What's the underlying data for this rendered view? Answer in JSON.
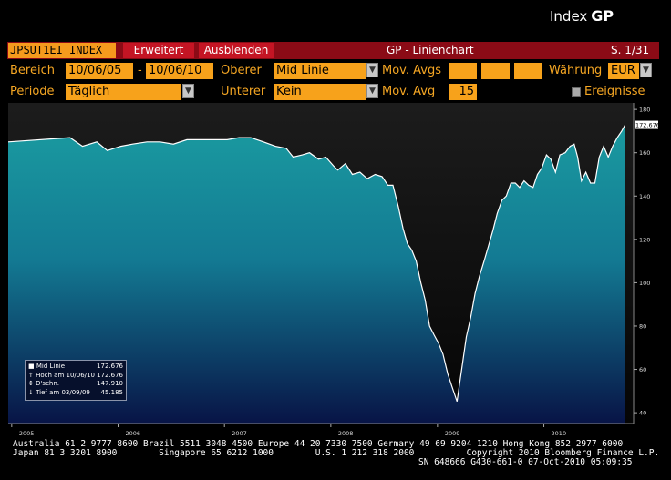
{
  "window": {
    "title": "Index",
    "title_bold": "GP"
  },
  "toolbar": {
    "ticker": "JPSUT1EI INDEX",
    "extended_label": "Erweitert",
    "hide_label": "Ausblenden",
    "chart_title": "GP - Linienchart",
    "page": "S. 1/31"
  },
  "controls": {
    "range_label": "Bereich",
    "date_from": "10/06/05",
    "date_sep": "-",
    "date_to": "10/06/10",
    "upper_label": "Oberer",
    "upper_value": "Mid Linie",
    "mov_avgs_label": "Mov. Avgs",
    "currency_label": "Währung",
    "currency_value": "EUR",
    "period_label": "Periode",
    "period_value": "Täglich",
    "lower_label": "Unterer",
    "lower_value": "Kein",
    "mov_avg_label": "Mov. Avg",
    "mov_avg_value": "15",
    "events_label": "Ereignisse"
  },
  "legend": {
    "rows": [
      {
        "label": "Mid Linie",
        "value": "172.676"
      },
      {
        "label": "Hoch am 10/06/10",
        "value": "172.676"
      },
      {
        "label": "D'schn.",
        "value": "147.910"
      },
      {
        "label": "Tief am 03/09/09",
        "value": "45.185"
      }
    ]
  },
  "footer": {
    "line1": "Australia 61 2 9777 8600 Brazil 5511 3048 4500 Europe 44 20 7330 7500 Germany 49 69 9204 1210 Hong Kong 852 2977 6000",
    "line2": "Japan 81 3 3201 8900        Singapore 65 6212 1000        U.S. 1 212 318 2000          Copyright 2010 Bloomberg Finance L.P.",
    "line3": "SN 648666 G430-661-0 07-Oct-2010 05:09:35"
  },
  "colors": {
    "accent": "#f7a21b",
    "bar": "#8b0b16",
    "fill_top": "#1a9aa0",
    "fill_bottom": "#0a1a4a"
  },
  "chart_data": {
    "type": "area",
    "title": "",
    "x_tick_labels": [
      "2005",
      "2006",
      "2007",
      "2008",
      "2009",
      "2010"
    ],
    "y_ticks": [
      40,
      60,
      80,
      100,
      120,
      140,
      160,
      180
    ],
    "ylim": [
      35,
      183
    ],
    "last_value_label": "172.676",
    "series": [
      {
        "name": "Mid Linie",
        "points": [
          [
            "2005-06-10",
            165
          ],
          [
            "2005-07-20",
            167
          ],
          [
            "2005-09-01",
            163
          ],
          [
            "2005-10-20",
            165
          ],
          [
            "2005-11-25",
            161
          ],
          [
            "2006-01-10",
            163
          ],
          [
            "2006-02-20",
            164
          ],
          [
            "2006-04-10",
            165
          ],
          [
            "2006-05-25",
            165
          ],
          [
            "2006-07-10",
            164
          ],
          [
            "2006-08-25",
            166
          ],
          [
            "2006-10-10",
            166
          ],
          [
            "2006-11-25",
            166
          ],
          [
            "2007-01-10",
            166
          ],
          [
            "2007-02-20",
            167
          ],
          [
            "2007-04-01",
            167
          ],
          [
            "2007-05-15",
            165
          ],
          [
            "2007-06-25",
            163
          ],
          [
            "2007-08-01",
            162
          ],
          [
            "2007-08-25",
            158
          ],
          [
            "2007-09-25",
            159
          ],
          [
            "2007-10-20",
            160
          ],
          [
            "2007-11-20",
            157
          ],
          [
            "2007-12-15",
            158
          ],
          [
            "2008-01-10",
            154
          ],
          [
            "2008-01-25",
            152
          ],
          [
            "2008-02-20",
            155
          ],
          [
            "2008-03-15",
            150
          ],
          [
            "2008-04-10",
            151
          ],
          [
            "2008-05-05",
            148
          ],
          [
            "2008-06-01",
            150
          ],
          [
            "2008-06-25",
            149
          ],
          [
            "2008-07-15",
            145
          ],
          [
            "2008-08-01",
            145
          ],
          [
            "2008-08-20",
            135
          ],
          [
            "2008-09-05",
            125
          ],
          [
            "2008-09-20",
            118
          ],
          [
            "2008-10-05",
            115
          ],
          [
            "2008-10-20",
            110
          ],
          [
            "2008-11-05",
            100
          ],
          [
            "2008-11-20",
            92
          ],
          [
            "2008-12-05",
            80
          ],
          [
            "2008-12-20",
            76
          ],
          [
            "2009-01-05",
            72
          ],
          [
            "2009-01-20",
            67
          ],
          [
            "2009-02-05",
            58
          ],
          [
            "2009-02-20",
            52
          ],
          [
            "2009-03-09",
            45.185
          ],
          [
            "2009-03-25",
            60
          ],
          [
            "2009-04-10",
            75
          ],
          [
            "2009-04-25",
            84
          ],
          [
            "2009-05-10",
            95
          ],
          [
            "2009-05-25",
            103
          ],
          [
            "2009-06-10",
            110
          ],
          [
            "2009-06-25",
            117
          ],
          [
            "2009-07-10",
            124
          ],
          [
            "2009-07-25",
            132
          ],
          [
            "2009-08-10",
            138
          ],
          [
            "2009-08-25",
            140
          ],
          [
            "2009-09-10",
            146
          ],
          [
            "2009-09-25",
            146
          ],
          [
            "2009-10-10",
            144
          ],
          [
            "2009-10-25",
            147
          ],
          [
            "2009-11-10",
            145
          ],
          [
            "2009-11-25",
            144
          ],
          [
            "2009-12-10",
            150
          ],
          [
            "2009-12-25",
            153
          ],
          [
            "2010-01-10",
            159
          ],
          [
            "2010-01-25",
            157
          ],
          [
            "2010-02-10",
            151
          ],
          [
            "2010-02-25",
            159
          ],
          [
            "2010-03-15",
            160
          ],
          [
            "2010-04-01",
            163
          ],
          [
            "2010-04-15",
            164
          ],
          [
            "2010-04-27",
            158
          ],
          [
            "2010-05-10",
            147
          ],
          [
            "2010-05-25",
            151
          ],
          [
            "2010-06-10",
            146
          ],
          [
            "2010-06-25",
            146
          ],
          [
            "2010-07-10",
            158
          ],
          [
            "2010-07-25",
            163
          ],
          [
            "2010-08-10",
            158
          ],
          [
            "2010-08-25",
            163
          ],
          [
            "2010-09-10",
            167
          ],
          [
            "2010-09-25",
            170
          ],
          [
            "2010-10-06",
            172.676
          ]
        ]
      }
    ]
  }
}
